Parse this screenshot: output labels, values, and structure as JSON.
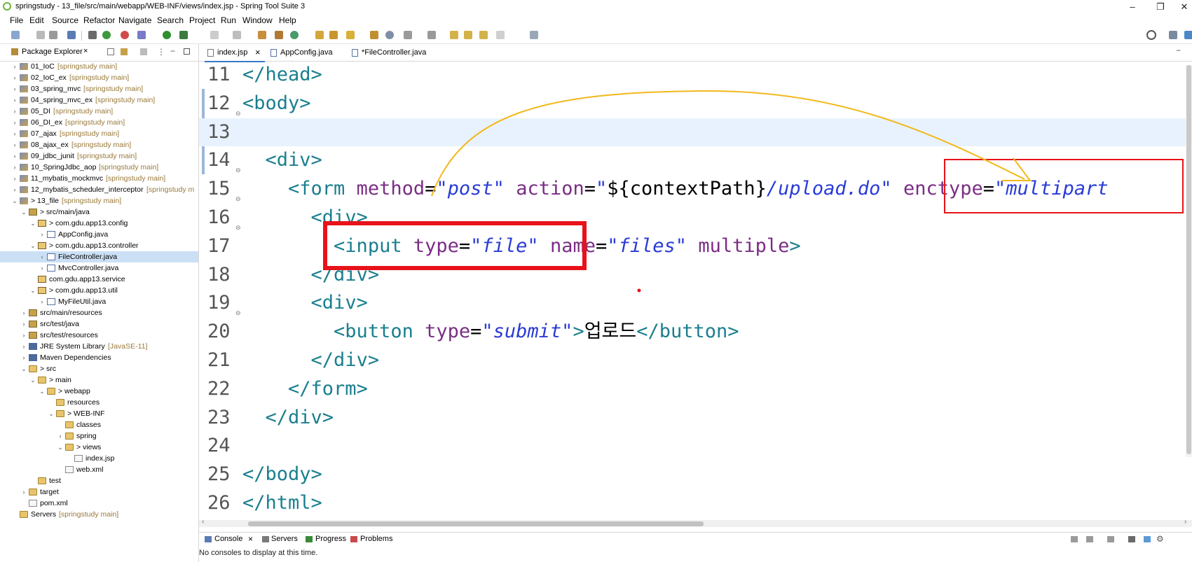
{
  "window": {
    "title": "springstudy - 13_file/src/main/webapp/WEB-INF/views/index.jsp - Spring Tool Suite 3",
    "minimize": "–",
    "restore": "❐",
    "close": "✕"
  },
  "menu": [
    "File",
    "Edit",
    "Source",
    "Refactor",
    "Navigate",
    "Search",
    "Project",
    "Run",
    "Window",
    "Help"
  ],
  "explorer": {
    "tab_label": "Package Explorer",
    "tab_close": "×",
    "tree": [
      {
        "label": "01_IoC",
        "extra": "[springstudy main]",
        "icon": "project-icon"
      },
      {
        "label": "02_IoC_ex",
        "extra": "[springstudy main]",
        "icon": "project-icon"
      },
      {
        "label": "03_spring_mvc",
        "extra": "[springstudy main]",
        "icon": "project-icon"
      },
      {
        "label": "04_spring_mvc_ex",
        "extra": "[springstudy main]",
        "icon": "project-icon"
      },
      {
        "label": "05_DI",
        "extra": "[springstudy main]",
        "icon": "project-icon"
      },
      {
        "label": "06_DI_ex",
        "extra": "[springstudy main]",
        "icon": "project-icon"
      },
      {
        "label": "07_ajax",
        "extra": "[springstudy main]",
        "icon": "project-icon"
      },
      {
        "label": "08_ajax_ex",
        "extra": "[springstudy main]",
        "icon": "project-icon"
      },
      {
        "label": "09_jdbc_junit",
        "extra": "[springstudy main]",
        "icon": "project-icon"
      },
      {
        "label": "10_SpringJdbc_aop",
        "extra": "[springstudy main]",
        "icon": "project-icon"
      },
      {
        "label": "11_mybatis_mockmvc",
        "extra": "[springstudy main]",
        "icon": "project-icon"
      },
      {
        "label": "12_mybatis_scheduler_interceptor",
        "extra": "[springstudy m",
        "icon": "project-icon"
      },
      {
        "label": "> 13_file",
        "extra": "[springstudy main]",
        "icon": "project-icon"
      },
      {
        "label": "> src/main/java",
        "extra": "",
        "icon": "source-folder-icon"
      },
      {
        "label": "> com.gdu.app13.config",
        "extra": "",
        "icon": "package-icon"
      },
      {
        "label": "AppConfig.java",
        "extra": "",
        "icon": "java-file-icon"
      },
      {
        "label": "> com.gdu.app13.controller",
        "extra": "",
        "icon": "package-icon"
      },
      {
        "label": "FileController.java",
        "extra": "",
        "icon": "java-file-icon"
      },
      {
        "label": "MvcController.java",
        "extra": "",
        "icon": "java-file-icon"
      },
      {
        "label": "com.gdu.app13.service",
        "extra": "",
        "icon": "package-icon"
      },
      {
        "label": "> com.gdu.app13.util",
        "extra": "",
        "icon": "package-icon"
      },
      {
        "label": "MyFileUtil.java",
        "extra": "",
        "icon": "java-file-icon"
      },
      {
        "label": "src/main/resources",
        "extra": "",
        "icon": "source-folder-icon"
      },
      {
        "label": "src/test/java",
        "extra": "",
        "icon": "source-folder-icon"
      },
      {
        "label": "src/test/resources",
        "extra": "",
        "icon": "source-folder-icon"
      },
      {
        "label": "JRE System Library",
        "extra": "[JavaSE-11]",
        "icon": "library-icon"
      },
      {
        "label": "Maven Dependencies",
        "extra": "",
        "icon": "library-icon"
      },
      {
        "label": "> src",
        "extra": "",
        "icon": "folder-icon"
      },
      {
        "label": "> main",
        "extra": "",
        "icon": "folder-icon"
      },
      {
        "label": "> webapp",
        "extra": "",
        "icon": "folder-icon"
      },
      {
        "label": "resources",
        "extra": "",
        "icon": "folder-icon"
      },
      {
        "label": "> WEB-INF",
        "extra": "",
        "icon": "folder-icon"
      },
      {
        "label": "classes",
        "extra": "",
        "icon": "folder-icon"
      },
      {
        "label": "spring",
        "extra": "",
        "icon": "folder-icon"
      },
      {
        "label": "> views",
        "extra": "",
        "icon": "folder-icon"
      },
      {
        "label": "index.jsp",
        "extra": "",
        "icon": "file-icon"
      },
      {
        "label": "web.xml",
        "extra": "",
        "icon": "file-icon"
      },
      {
        "label": "test",
        "extra": "",
        "icon": "folder-icon"
      },
      {
        "label": "target",
        "extra": "",
        "icon": "folder-icon"
      },
      {
        "label": "pom.xml",
        "extra": "",
        "icon": "file-icon"
      },
      {
        "label": "Servers",
        "extra": "[springstudy main]",
        "icon": "folder-icon"
      }
    ]
  },
  "editor": {
    "tabs": [
      {
        "label": "index.jsp",
        "close": "×",
        "active": true
      },
      {
        "label": "AppConfig.java",
        "close": "",
        "active": false
      },
      {
        "label": "*FileController.java",
        "close": "",
        "active": false
      }
    ],
    "lines": [
      {
        "num": "11",
        "segments": [
          {
            "t": "tag",
            "v": "</head>"
          }
        ]
      },
      {
        "num": "12",
        "fold": true,
        "segments": [
          {
            "t": "tag",
            "v": "<body>"
          }
        ]
      },
      {
        "num": "13",
        "current": true,
        "segments": []
      },
      {
        "num": "14",
        "fold": true,
        "segments": [
          {
            "t": "txt",
            "v": "  "
          },
          {
            "t": "tag",
            "v": "<div>"
          }
        ]
      },
      {
        "num": "15",
        "fold": true,
        "segments": [
          {
            "t": "txt",
            "v": "    "
          },
          {
            "t": "tag",
            "v": "<form "
          },
          {
            "t": "attr",
            "v": "method"
          },
          {
            "t": "txt",
            "v": "="
          },
          {
            "t": "val",
            "v": "\"post\""
          },
          {
            "t": "txt",
            "v": " "
          },
          {
            "t": "attr",
            "v": "action"
          },
          {
            "t": "txt",
            "v": "="
          },
          {
            "t": "val",
            "v": "\""
          },
          {
            "t": "txt",
            "v": "${contextPath}"
          },
          {
            "t": "val",
            "v": "/upload.do\""
          },
          {
            "t": "txt",
            "v": " "
          },
          {
            "t": "attr",
            "v": "enctype"
          },
          {
            "t": "txt",
            "v": "="
          },
          {
            "t": "val",
            "v": "\"multipart"
          }
        ]
      },
      {
        "num": "16",
        "fold": true,
        "segments": [
          {
            "t": "txt",
            "v": "      "
          },
          {
            "t": "tag",
            "v": "<div>"
          }
        ]
      },
      {
        "num": "17",
        "segments": [
          {
            "t": "txt",
            "v": "        "
          },
          {
            "t": "tag",
            "v": "<input "
          },
          {
            "t": "attr",
            "v": "type"
          },
          {
            "t": "txt",
            "v": "="
          },
          {
            "t": "val",
            "v": "\"file\""
          },
          {
            "t": "txt",
            "v": " "
          },
          {
            "t": "attr",
            "v": "name"
          },
          {
            "t": "txt",
            "v": "="
          },
          {
            "t": "val",
            "v": "\"files\""
          },
          {
            "t": "txt",
            "v": " "
          },
          {
            "t": "attr",
            "v": "multiple"
          },
          {
            "t": "tag",
            "v": ">"
          }
        ]
      },
      {
        "num": "18",
        "segments": [
          {
            "t": "txt",
            "v": "      "
          },
          {
            "t": "tag",
            "v": "</div>"
          }
        ]
      },
      {
        "num": "19",
        "fold": true,
        "segments": [
          {
            "t": "txt",
            "v": "      "
          },
          {
            "t": "tag",
            "v": "<div>"
          }
        ]
      },
      {
        "num": "20",
        "segments": [
          {
            "t": "txt",
            "v": "        "
          },
          {
            "t": "tag",
            "v": "<button "
          },
          {
            "t": "attr",
            "v": "type"
          },
          {
            "t": "txt",
            "v": "="
          },
          {
            "t": "val",
            "v": "\"submit\""
          },
          {
            "t": "tag",
            "v": ">"
          },
          {
            "t": "txt",
            "v": "업로드"
          },
          {
            "t": "tag",
            "v": "</button>"
          }
        ]
      },
      {
        "num": "21",
        "segments": [
          {
            "t": "txt",
            "v": "      "
          },
          {
            "t": "tag",
            "v": "</div>"
          }
        ]
      },
      {
        "num": "22",
        "segments": [
          {
            "t": "txt",
            "v": "    "
          },
          {
            "t": "tag",
            "v": "</form>"
          }
        ]
      },
      {
        "num": "23",
        "segments": [
          {
            "t": "txt",
            "v": "  "
          },
          {
            "t": "tag",
            "v": "</div>"
          }
        ]
      },
      {
        "num": "24",
        "segments": []
      },
      {
        "num": "25",
        "segments": [
          {
            "t": "tag",
            "v": "</body>"
          }
        ]
      },
      {
        "num": "26",
        "segments": [
          {
            "t": "tag",
            "v": "</html>"
          }
        ]
      }
    ]
  },
  "console": {
    "tabs": [
      {
        "label": "Console",
        "close": "×"
      },
      {
        "label": "Servers",
        "close": ""
      },
      {
        "label": "Progress",
        "close": ""
      },
      {
        "label": "Problems",
        "close": ""
      }
    ],
    "message": "No consoles to display at this time."
  },
  "colors": {
    "tag": "#1a7f8e",
    "attr": "#7a2d84",
    "value": "#2a3bd6",
    "annotation_box": "#e8121a",
    "annotation_arrow": "#f3b81a"
  }
}
